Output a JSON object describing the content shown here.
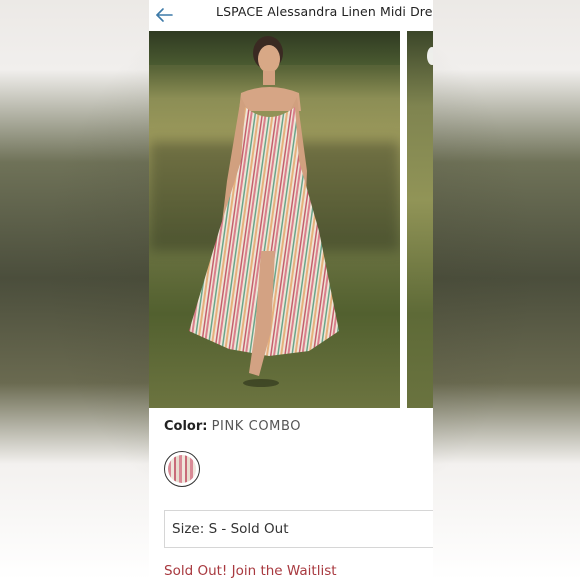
{
  "header": {
    "title": "LSPACE Alessandra Linen Midi Dress"
  },
  "icons": {
    "back": "arrow-left-icon"
  },
  "colors": {
    "accent": "#3d7aa8",
    "waitlist": "#a8393f"
  },
  "product": {
    "color_label": "Color:",
    "color_value": "PINK COMBO",
    "size_label": "Size:",
    "size_value": "S - Sold Out",
    "waitlist_text": "Sold Out! Join the Waitlist"
  }
}
